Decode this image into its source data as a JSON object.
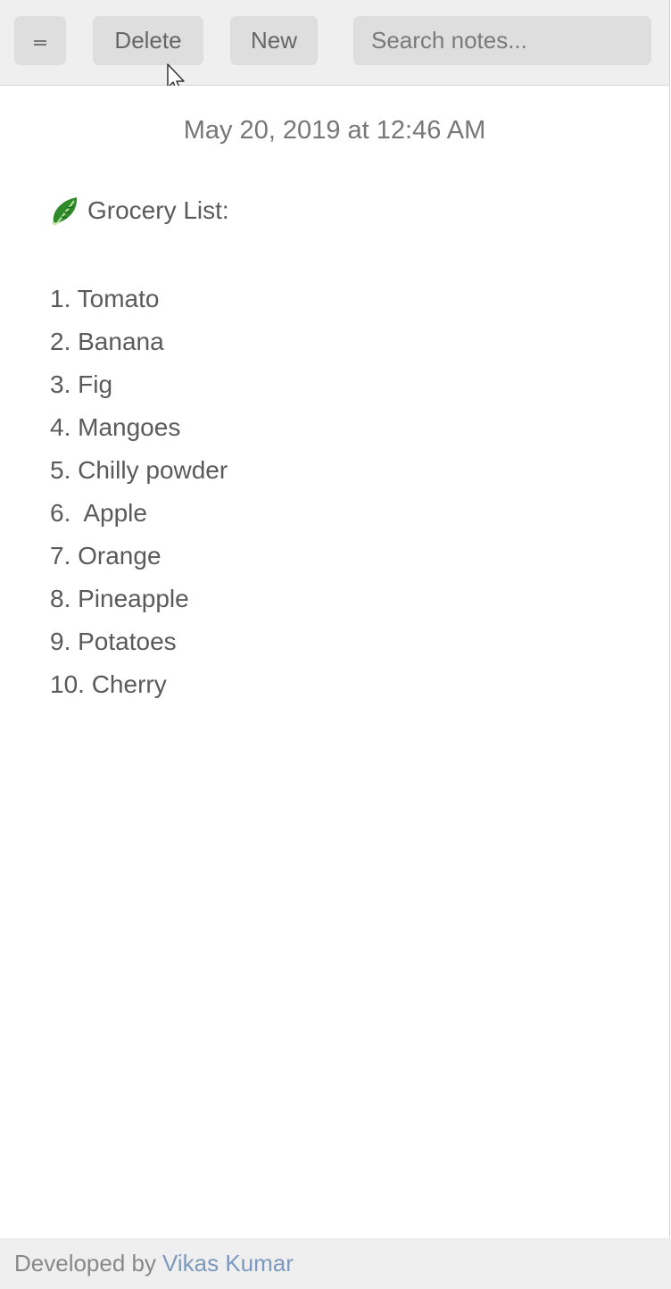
{
  "toolbar": {
    "delete_label": "Delete",
    "new_label": "New",
    "search_placeholder": "Search notes..."
  },
  "note": {
    "timestamp": "May 20, 2019 at 12:46 AM",
    "title_icon": "leafy-green-icon",
    "title": "Grocery List:",
    "items": [
      "1. Tomato",
      "2. Banana",
      "3. Fig",
      "4. Mangoes",
      "5. Chilly powder",
      "6.  Apple",
      "7. Orange",
      "8. Pineapple",
      "9. Potatoes",
      "10. Cherry"
    ]
  },
  "footer": {
    "prefix": "Developed by",
    "author": "Vikas Kumar"
  },
  "colors": {
    "toolbar_bg": "#efefef",
    "button_bg": "#dedede",
    "link": "#7c99bd",
    "text": "#5a5a5a"
  }
}
